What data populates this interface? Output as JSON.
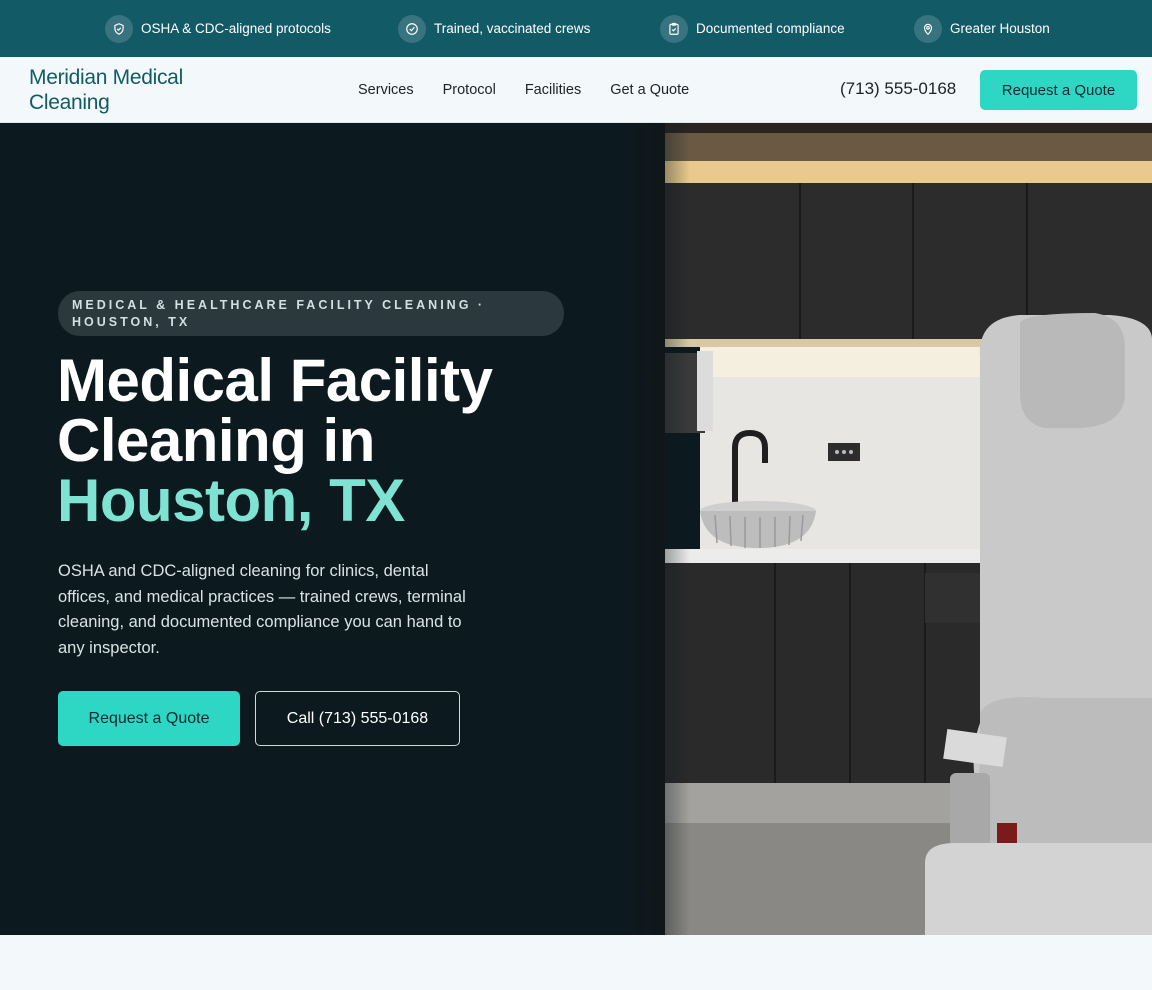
{
  "topbar": {
    "items": [
      {
        "icon": "shield-check-icon",
        "label": "OSHA & CDC-aligned protocols"
      },
      {
        "icon": "check-circle-icon",
        "label": "Trained, vaccinated crews"
      },
      {
        "icon": "clipboard-check-icon",
        "label": "Documented compliance"
      },
      {
        "icon": "map-pin-icon",
        "label": "Greater Houston"
      }
    ]
  },
  "header": {
    "logo": "Meridian Medical Cleaning",
    "nav": [
      "Services",
      "Protocol",
      "Facilities",
      "Get a Quote"
    ],
    "phone": "(713) 555-0168",
    "cta": "Request a Quote"
  },
  "hero": {
    "eyebrow": "MEDICAL & HEALTHCARE FACILITY CLEANING · HOUSTON, TX",
    "title_line1": "Medical Facility",
    "title_line2": "Cleaning in",
    "title_accent": "Houston, TX",
    "lead": "OSHA and CDC-aligned cleaning for clinics, dental offices, and medical practices — trained crews, terminal cleaning, and documented compliance you can hand to any inspector.",
    "primary_cta": "Request a Quote",
    "secondary_cta": "Call (713) 555-0168"
  },
  "colors": {
    "brand": "#135a67",
    "accent": "#2ed6c4",
    "accent_text": "#7fe3d4",
    "hero_bg": "#0c1a1f"
  }
}
